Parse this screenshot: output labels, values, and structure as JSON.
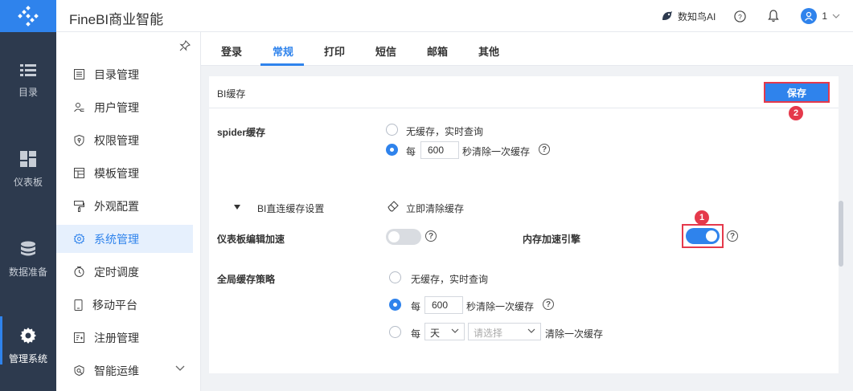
{
  "app": {
    "title": "FineBI商业智能"
  },
  "topbar": {
    "ai_label": "数知鸟AI",
    "user_name": "1"
  },
  "leftnav": [
    {
      "label": "目录",
      "icon": "list-icon"
    },
    {
      "label": "仪表板",
      "icon": "dashboard-icon"
    },
    {
      "label": "数据准备",
      "icon": "database-icon"
    },
    {
      "label": "管理系统",
      "icon": "gear-icon"
    }
  ],
  "submenu": [
    {
      "label": "目录管理",
      "icon": "catalog-icon"
    },
    {
      "label": "用户管理",
      "icon": "user-icon"
    },
    {
      "label": "权限管理",
      "icon": "shield-icon"
    },
    {
      "label": "模板管理",
      "icon": "template-icon"
    },
    {
      "label": "外观配置",
      "icon": "paint-icon"
    },
    {
      "label": "系统管理",
      "icon": "gear-icon"
    },
    {
      "label": "定时调度",
      "icon": "clock-icon"
    },
    {
      "label": "移动平台",
      "icon": "mobile-icon"
    },
    {
      "label": "注册管理",
      "icon": "register-icon"
    },
    {
      "label": "智能运维",
      "icon": "ops-icon"
    }
  ],
  "tabs": [
    "登录",
    "常规",
    "打印",
    "短信",
    "邮箱",
    "其他"
  ],
  "content": {
    "header_title": "BI缓存",
    "save_label": "保存",
    "badge1": "1",
    "badge2": "2",
    "spider": {
      "label": "spider缓存",
      "option_none": "无缓存，实时查询",
      "option_every": "每",
      "value": "600",
      "suffix": "秒清除一次缓存"
    },
    "direct": {
      "label": "BI直连缓存设置",
      "clear_now": "立即清除缓存"
    },
    "dashboard_accel": {
      "label": "仪表板编辑加速",
      "on": false
    },
    "memory_engine": {
      "label": "内存加速引擎",
      "on": true
    },
    "global": {
      "label": "全局缓存策略",
      "option_none": "无缓存，实时查询",
      "option_every": "每",
      "value": "600",
      "suffix": "秒清除一次缓存",
      "option_every2": "每",
      "period": "天",
      "select_placeholder": "请选择",
      "suffix2": "清除一次缓存"
    }
  },
  "colors": {
    "accent": "#2f83ec",
    "nav_bg": "#2d3a4e",
    "highlight_red": "#e5394b"
  }
}
